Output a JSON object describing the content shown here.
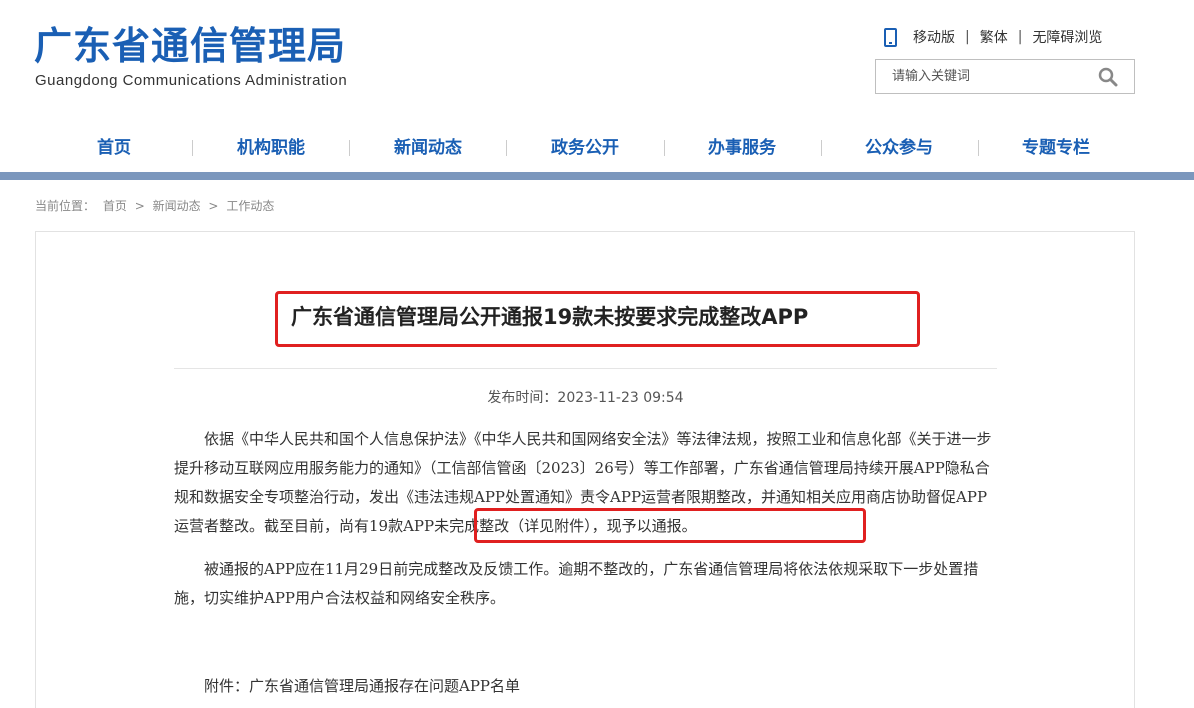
{
  "header": {
    "logo_cn": "广东省通信管理局",
    "logo_en": "Guangdong Communications Administration",
    "links": [
      "移动版",
      "繁体",
      "无障碍浏览"
    ],
    "separator": "|",
    "search_placeholder": "请输入关键词"
  },
  "nav": {
    "items": [
      "首页",
      "机构职能",
      "新闻动态",
      "政务公开",
      "办事服务",
      "公众参与",
      "专题专栏"
    ]
  },
  "breadcrumb": {
    "label": "当前位置：",
    "items": [
      "首页",
      ">",
      "新闻动态",
      ">",
      "工作动态"
    ]
  },
  "article": {
    "title": "广东省通信管理局公开通报19款未按要求完成整改APP",
    "pubtime": "发布时间：2023-11-23 09:54",
    "p1": "依据《中华人民共和国个人信息保护法》《中华人民共和国网络安全法》等法律法规，按照工业和信息化部《关于进一步提升移动互联网应用服务能力的通知》（工信部信管函〔2023〕26号）等工作部署，广东省通信管理局持续开展APP隐私合规和数据安全专项整治行动，发出《违法违规APP处置通知》责令APP运营者限期整改，并通知相关应用商店协助督促APP运营者整改。截至目前，尚有19款APP未完成整改（详见附件），现予以通报。",
    "p2": "被通报的APP应在11月29日前完成整改及反馈工作。逾期不整改的，广东省通信管理局将依法依规采取下一步处置措施，切实维护APP用户合法权益和网络安全秩序。",
    "p3": "附件：广东省通信管理局通报存在问题APP名单"
  },
  "colors": {
    "brand": "#1a5fb4",
    "nav_bar": "#7b97bd",
    "highlight": "#e02020"
  }
}
